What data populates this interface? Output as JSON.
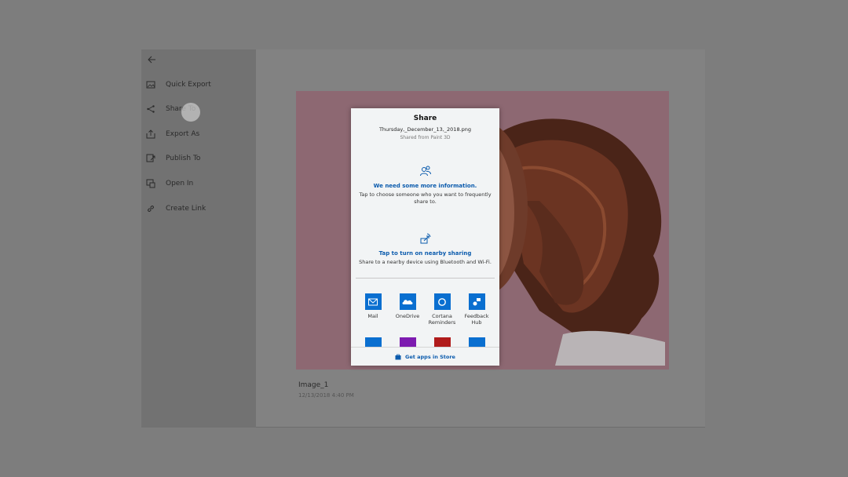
{
  "sidebar": {
    "items": [
      {
        "label": "Quick Export",
        "icon": "image-icon"
      },
      {
        "label": "Share To",
        "icon": "share-icon"
      },
      {
        "label": "Export As",
        "icon": "export-icon"
      },
      {
        "label": "Publish To",
        "icon": "publish-icon"
      },
      {
        "label": "Open In",
        "icon": "open-in-icon"
      },
      {
        "label": "Create Link",
        "icon": "link-icon"
      }
    ]
  },
  "image": {
    "title": "Image_1",
    "date": "12/13/2018 4:40 PM"
  },
  "share": {
    "title": "Share",
    "file": "Thursday,_December_13,_2018.png",
    "source": "Shared from Paint 3D",
    "people": {
      "title": "We need some more information.",
      "desc": "Tap to choose someone who you want to frequently share to."
    },
    "nearby": {
      "title": "Tap to turn on nearby sharing",
      "desc": "Share to a nearby device using Bluetooth and Wi-Fi."
    },
    "apps": [
      {
        "label": "Mail",
        "color": "#0a6fd0"
      },
      {
        "label": "OneDrive",
        "color": "#0a6fd0"
      },
      {
        "label": "Cortana Reminders",
        "color": "#0a6fd0"
      },
      {
        "label": "Feedback Hub",
        "color": "#0a6fd0"
      }
    ],
    "apps_row2_colors": [
      "#0a6fd0",
      "#7d1bb0",
      "#b01b1b",
      "#0a6fd0"
    ],
    "footer": "Get apps in Store"
  }
}
